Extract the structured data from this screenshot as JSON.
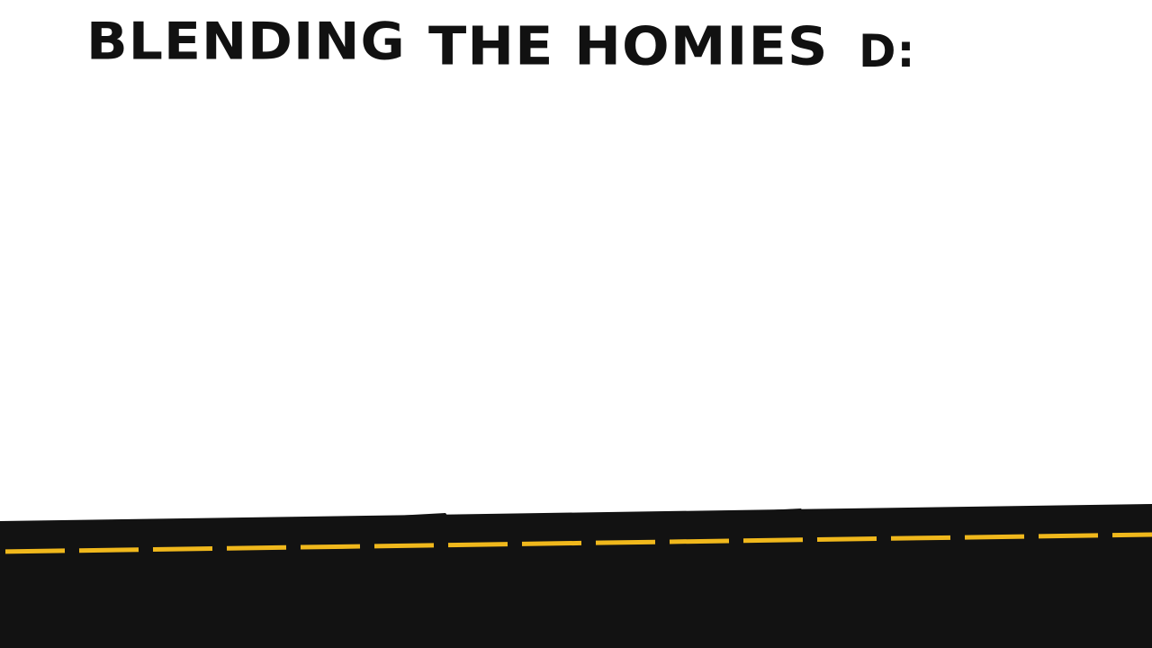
{
  "title_parts": {
    "part1": "BLENDING",
    "part2": "THE HOMIES",
    "part3": "D:"
  },
  "colors": {
    "background": "#ffffff",
    "text": "#111111",
    "road": "#121212",
    "lane_marking": "#f0b81c"
  }
}
